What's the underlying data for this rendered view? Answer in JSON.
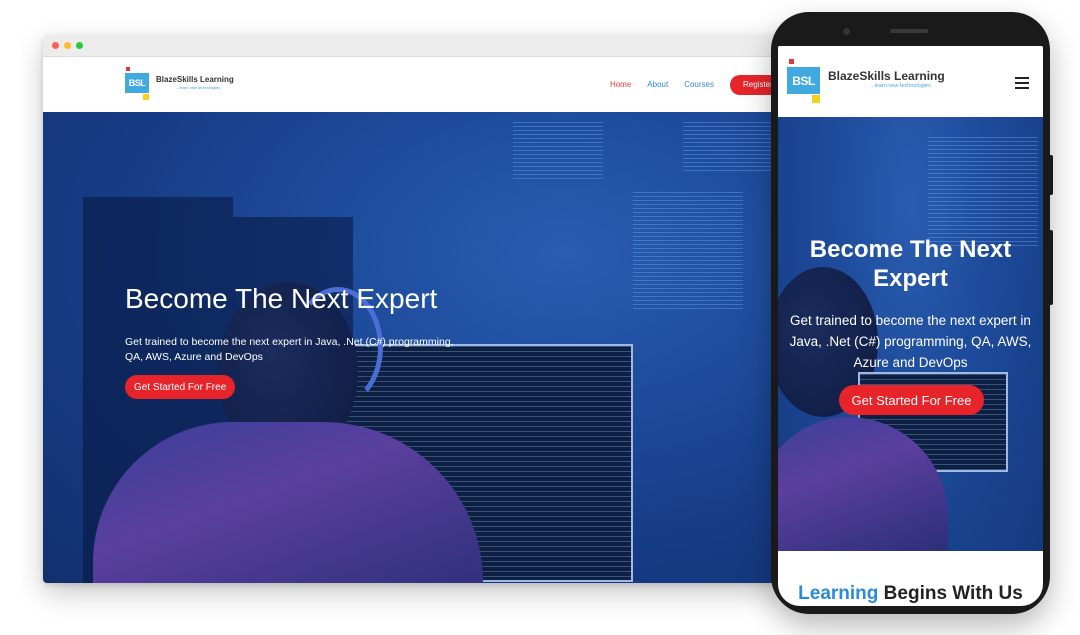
{
  "brand": {
    "logo_initials": "BSL",
    "name": "BlazeSkills Learning",
    "tagline": "...learn new technologies"
  },
  "desktop": {
    "nav": {
      "home": "Home",
      "about": "About",
      "courses": "Courses",
      "register": "Register For Free"
    },
    "hero": {
      "title": "Become The Next Expert",
      "subtitle": "Get trained to become the next expert in Java, .Net (C#) programming, QA, AWS, Azure and DevOps",
      "cta": "Get Started For Free"
    }
  },
  "mobile": {
    "menu_icon": "hamburger-icon",
    "hero": {
      "title": "Become The Next Expert",
      "subtitle": "Get trained to become the next expert in Java, .Net (C#) programming, QA, AWS, Azure and DevOps",
      "cta": "Get Started For Free"
    },
    "section": {
      "highlight": "Learning",
      "rest": " Begins With Us"
    }
  },
  "colors": {
    "accent_red": "#e8242b",
    "link_blue": "#2b8bd8",
    "hero_blue": "#1d4a9a"
  }
}
